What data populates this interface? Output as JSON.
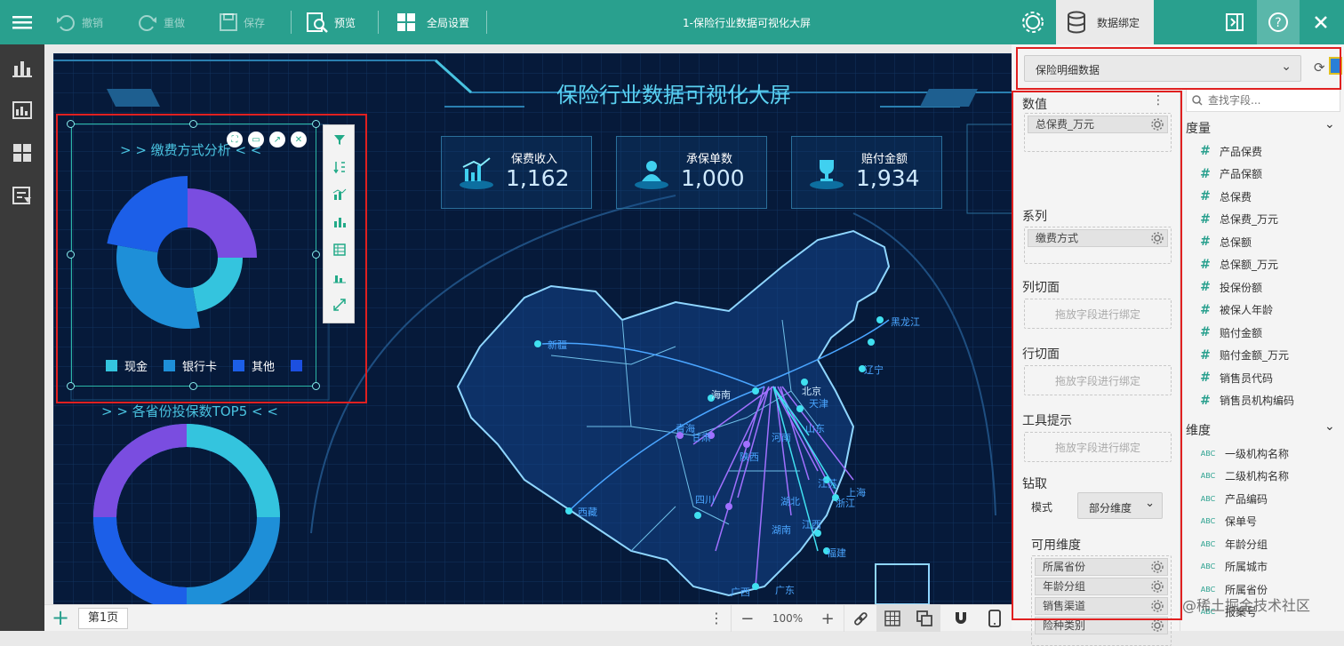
{
  "toolbar": {
    "undo": "撤销",
    "redo": "重做",
    "save": "保存",
    "preview": "预览",
    "global_settings": "全局设置",
    "title": "1-保险行业数据可视化大屏",
    "data_binding": "数据绑定"
  },
  "dashboard": {
    "title": "保险行业数据可视化大屏",
    "kpis": [
      {
        "label": "保费收入",
        "value": "1,162"
      },
      {
        "label": "承保单数",
        "value": "1,000"
      },
      {
        "label": "赔付金额",
        "value": "1,934"
      }
    ],
    "pie_title": "> > 缴费方式分析 < <",
    "pie_chart": {
      "type": "pie",
      "series_name": "缴费方式",
      "legend": [
        "现金",
        "银行卡",
        "其他"
      ],
      "colors": [
        "#7a4de0",
        "#1c5fe8",
        "#1e8fd8",
        "#34c4de"
      ]
    },
    "donut_title": "> > 各省份投保数TOP5 < <",
    "map_labels": [
      "新疆",
      "黑龙江",
      "辽宁",
      "北京",
      "天津",
      "山东",
      "江苏",
      "上海",
      "浙江",
      "福建",
      "西藏",
      "四川",
      "湖南",
      "湖北",
      "江西",
      "青海",
      "甘肃",
      "陕西",
      "河南",
      "广西",
      "广东",
      "海南"
    ]
  },
  "page_tab": "第1页",
  "zoom": "100%",
  "panel": {
    "dataset": "保险明细数据",
    "sections": {
      "values": "数值",
      "series": "系列",
      "col_slice": "列切面",
      "row_slice": "行切面",
      "tooltip": "工具提示",
      "drill": "钻取",
      "mode_label": "模式",
      "mode_value": "部分维度",
      "available_dims": "可用维度"
    },
    "values_field": "总保费_万元",
    "series_field": "缴费方式",
    "drop_placeholder": "拖放字段进行绑定",
    "available": [
      "所属省份",
      "年龄分组",
      "销售渠道",
      "险种类别"
    ],
    "search_placeholder": "查找字段...",
    "measures_title": "度量",
    "measures": [
      "产品保费",
      "产品保额",
      "总保费",
      "总保费_万元",
      "总保额",
      "总保额_万元",
      "投保份额",
      "被保人年龄",
      "赔付金额",
      "赔付金额_万元",
      "销售员代码",
      "销售员机构编码"
    ],
    "dimensions_title": "维度",
    "dimensions": [
      "一级机构名称",
      "二级机构名称",
      "产品编码",
      "保单号",
      "年龄分组",
      "所属城市",
      "所属省份",
      "报案号"
    ],
    "abc": "ABC",
    "hash": "#"
  },
  "watermark": "@稀土掘金技术社区"
}
